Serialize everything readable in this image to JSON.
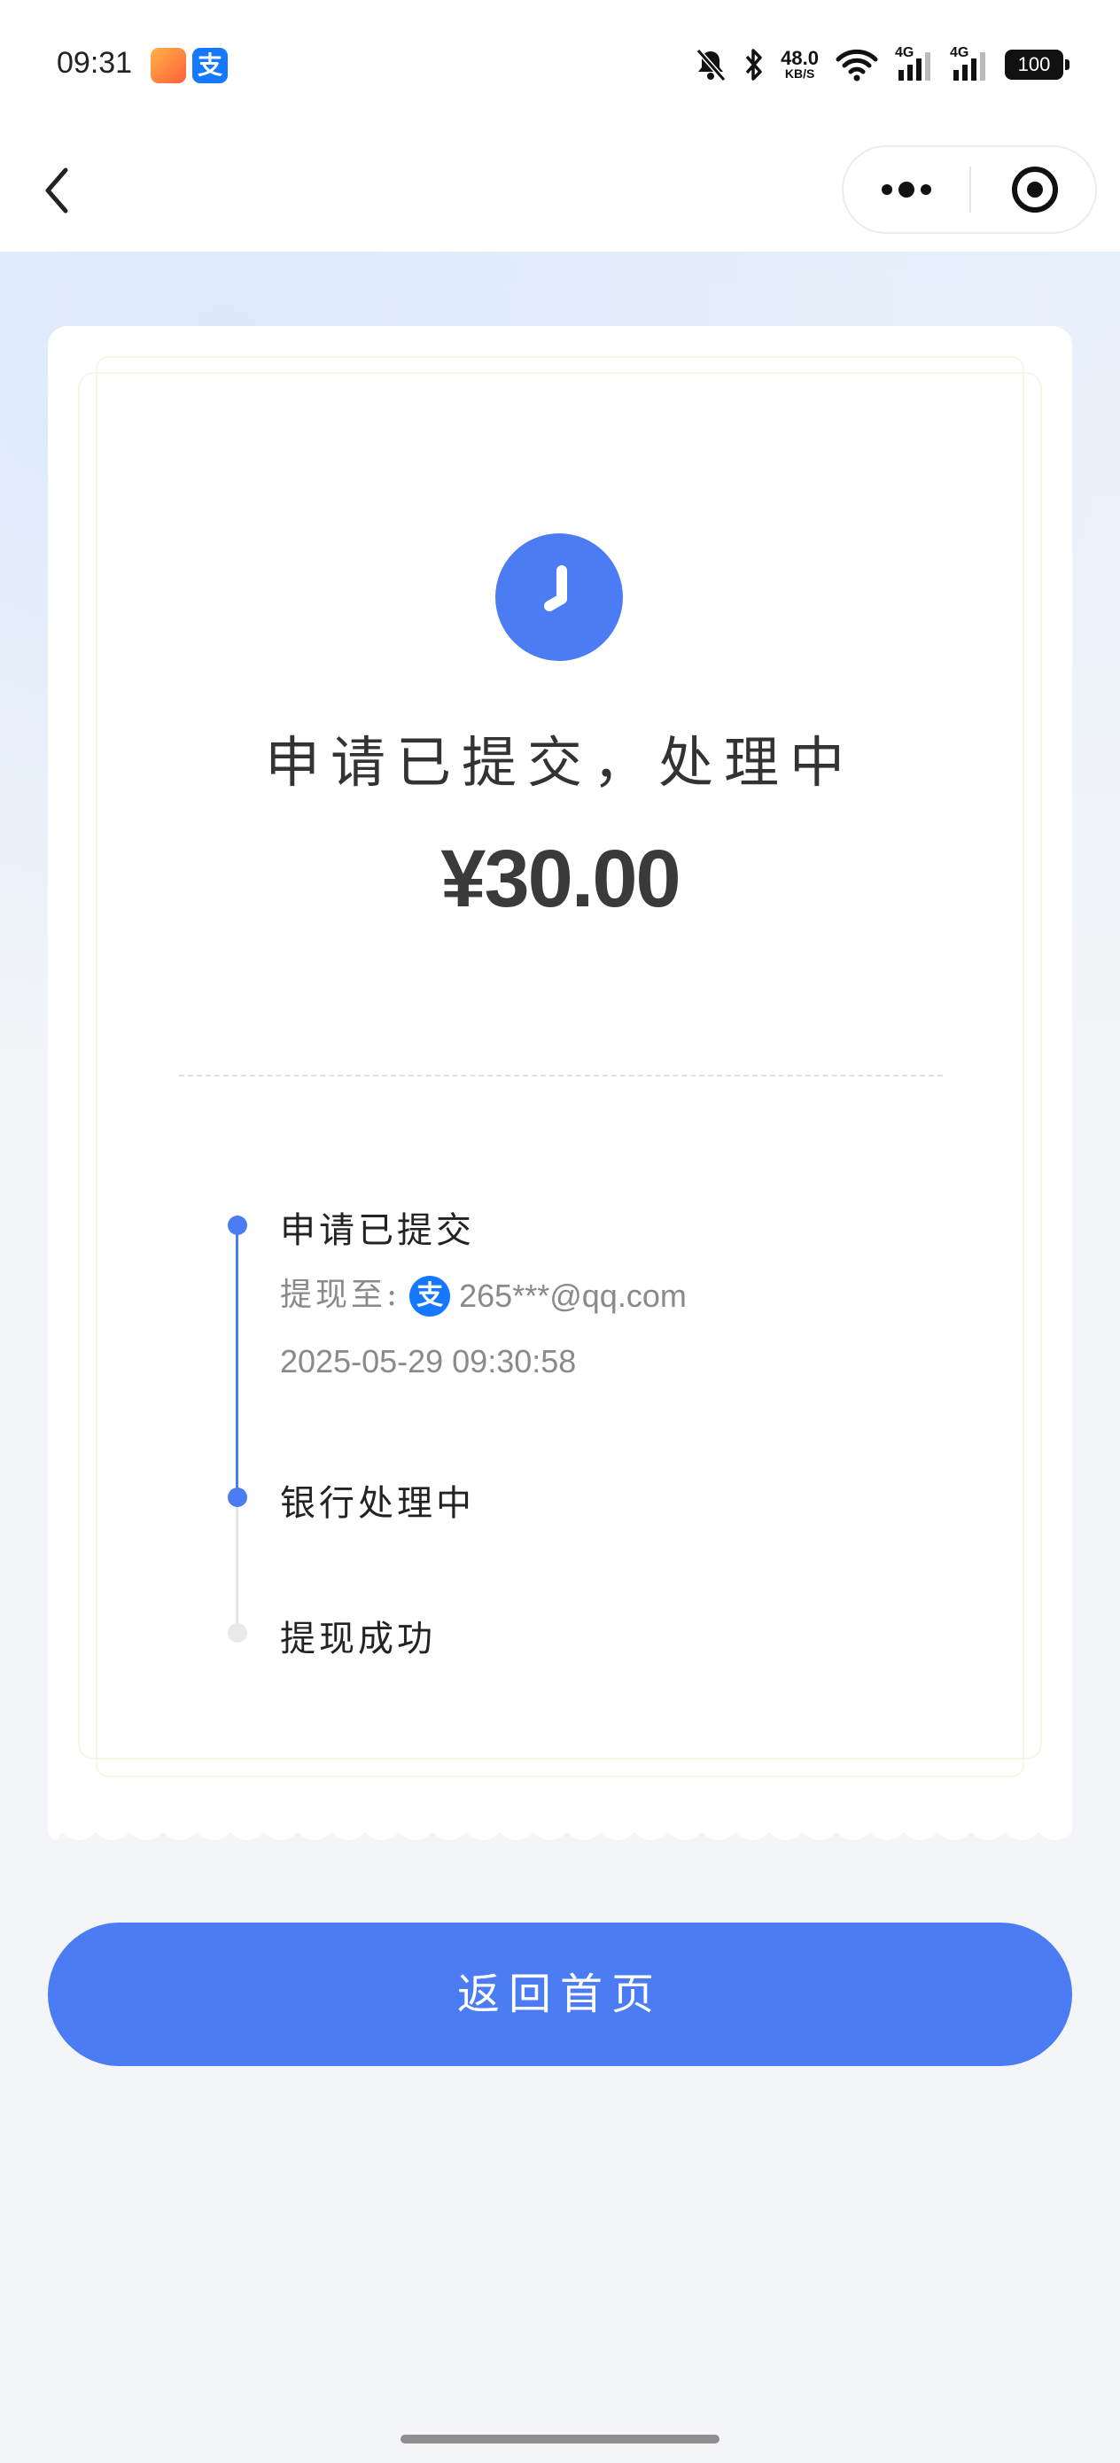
{
  "status_bar": {
    "time": "09:31",
    "alipay_glyph": "支",
    "net_speed": "48.0",
    "net_speed_unit": "KB/S",
    "signal_1": "4G",
    "signal_2": "4G",
    "battery": "100",
    "icons": [
      "mute-bell-icon",
      "bluetooth-icon",
      "wifi-icon",
      "cellular-signal-icon"
    ]
  },
  "nav": {
    "back_icon": "chevron-left-icon",
    "more_icon": "more-dots-icon",
    "close_icon": "target-close-icon"
  },
  "receipt": {
    "status_icon": "clock-icon",
    "status_title": "申请已提交，处理中",
    "amount": "¥30.00",
    "timeline": [
      {
        "label": "申请已提交",
        "state": "done",
        "detail_key": "提现至:",
        "alipay_glyph": "支",
        "account": "265***@qq.com",
        "time": "2025-05-29 09:30:58"
      },
      {
        "label": "银行处理中",
        "state": "current"
      },
      {
        "label": "提现成功",
        "state": "pending"
      }
    ]
  },
  "actions": {
    "home_button": "返回首页"
  },
  "colors": {
    "accent": "#4b7cf4",
    "alipay": "#1677ff",
    "background": "#f3f5f8"
  }
}
